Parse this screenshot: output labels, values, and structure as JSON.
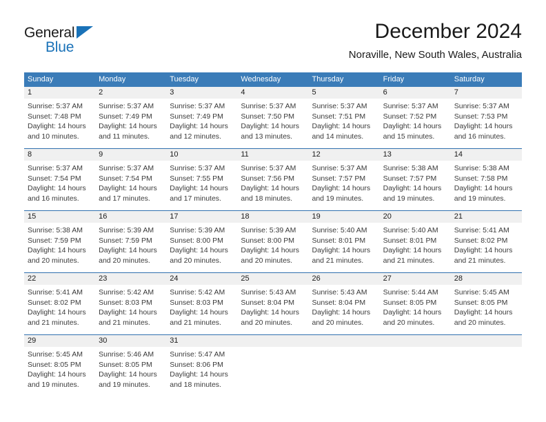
{
  "brand": {
    "name_dark": "General",
    "name_blue": "Blue",
    "triangle_icon": "triangle-icon",
    "accent_color": "#1a72b8"
  },
  "header": {
    "title": "December 2024",
    "subtitle": "Noraville, New South Wales, Australia"
  },
  "theme": {
    "header_blue": "#3b7cb8",
    "daynum_band": "#f0f0f0",
    "rule_blue": "#2f6fae",
    "text": "#3a3a3a"
  },
  "labels": {
    "sunrise_prefix": "Sunrise:",
    "sunset_prefix": "Sunset:",
    "daylight_prefix": "Daylight:"
  },
  "weekdays": [
    "Sunday",
    "Monday",
    "Tuesday",
    "Wednesday",
    "Thursday",
    "Friday",
    "Saturday"
  ],
  "weeks": [
    {
      "days": [
        {
          "day": "1",
          "sunrise": "Sunrise: 5:37 AM",
          "sunset": "Sunset: 7:48 PM",
          "daylight": "Daylight: 14 hours and 10 minutes."
        },
        {
          "day": "2",
          "sunrise": "Sunrise: 5:37 AM",
          "sunset": "Sunset: 7:49 PM",
          "daylight": "Daylight: 14 hours and 11 minutes."
        },
        {
          "day": "3",
          "sunrise": "Sunrise: 5:37 AM",
          "sunset": "Sunset: 7:49 PM",
          "daylight": "Daylight: 14 hours and 12 minutes."
        },
        {
          "day": "4",
          "sunrise": "Sunrise: 5:37 AM",
          "sunset": "Sunset: 7:50 PM",
          "daylight": "Daylight: 14 hours and 13 minutes."
        },
        {
          "day": "5",
          "sunrise": "Sunrise: 5:37 AM",
          "sunset": "Sunset: 7:51 PM",
          "daylight": "Daylight: 14 hours and 14 minutes."
        },
        {
          "day": "6",
          "sunrise": "Sunrise: 5:37 AM",
          "sunset": "Sunset: 7:52 PM",
          "daylight": "Daylight: 14 hours and 15 minutes."
        },
        {
          "day": "7",
          "sunrise": "Sunrise: 5:37 AM",
          "sunset": "Sunset: 7:53 PM",
          "daylight": "Daylight: 14 hours and 16 minutes."
        }
      ]
    },
    {
      "days": [
        {
          "day": "8",
          "sunrise": "Sunrise: 5:37 AM",
          "sunset": "Sunset: 7:54 PM",
          "daylight": "Daylight: 14 hours and 16 minutes."
        },
        {
          "day": "9",
          "sunrise": "Sunrise: 5:37 AM",
          "sunset": "Sunset: 7:54 PM",
          "daylight": "Daylight: 14 hours and 17 minutes."
        },
        {
          "day": "10",
          "sunrise": "Sunrise: 5:37 AM",
          "sunset": "Sunset: 7:55 PM",
          "daylight": "Daylight: 14 hours and 17 minutes."
        },
        {
          "day": "11",
          "sunrise": "Sunrise: 5:37 AM",
          "sunset": "Sunset: 7:56 PM",
          "daylight": "Daylight: 14 hours and 18 minutes."
        },
        {
          "day": "12",
          "sunrise": "Sunrise: 5:37 AM",
          "sunset": "Sunset: 7:57 PM",
          "daylight": "Daylight: 14 hours and 19 minutes."
        },
        {
          "day": "13",
          "sunrise": "Sunrise: 5:38 AM",
          "sunset": "Sunset: 7:57 PM",
          "daylight": "Daylight: 14 hours and 19 minutes."
        },
        {
          "day": "14",
          "sunrise": "Sunrise: 5:38 AM",
          "sunset": "Sunset: 7:58 PM",
          "daylight": "Daylight: 14 hours and 19 minutes."
        }
      ]
    },
    {
      "days": [
        {
          "day": "15",
          "sunrise": "Sunrise: 5:38 AM",
          "sunset": "Sunset: 7:59 PM",
          "daylight": "Daylight: 14 hours and 20 minutes."
        },
        {
          "day": "16",
          "sunrise": "Sunrise: 5:39 AM",
          "sunset": "Sunset: 7:59 PM",
          "daylight": "Daylight: 14 hours and 20 minutes."
        },
        {
          "day": "17",
          "sunrise": "Sunrise: 5:39 AM",
          "sunset": "Sunset: 8:00 PM",
          "daylight": "Daylight: 14 hours and 20 minutes."
        },
        {
          "day": "18",
          "sunrise": "Sunrise: 5:39 AM",
          "sunset": "Sunset: 8:00 PM",
          "daylight": "Daylight: 14 hours and 20 minutes."
        },
        {
          "day": "19",
          "sunrise": "Sunrise: 5:40 AM",
          "sunset": "Sunset: 8:01 PM",
          "daylight": "Daylight: 14 hours and 21 minutes."
        },
        {
          "day": "20",
          "sunrise": "Sunrise: 5:40 AM",
          "sunset": "Sunset: 8:01 PM",
          "daylight": "Daylight: 14 hours and 21 minutes."
        },
        {
          "day": "21",
          "sunrise": "Sunrise: 5:41 AM",
          "sunset": "Sunset: 8:02 PM",
          "daylight": "Daylight: 14 hours and 21 minutes."
        }
      ]
    },
    {
      "days": [
        {
          "day": "22",
          "sunrise": "Sunrise: 5:41 AM",
          "sunset": "Sunset: 8:02 PM",
          "daylight": "Daylight: 14 hours and 21 minutes."
        },
        {
          "day": "23",
          "sunrise": "Sunrise: 5:42 AM",
          "sunset": "Sunset: 8:03 PM",
          "daylight": "Daylight: 14 hours and 21 minutes."
        },
        {
          "day": "24",
          "sunrise": "Sunrise: 5:42 AM",
          "sunset": "Sunset: 8:03 PM",
          "daylight": "Daylight: 14 hours and 21 minutes."
        },
        {
          "day": "25",
          "sunrise": "Sunrise: 5:43 AM",
          "sunset": "Sunset: 8:04 PM",
          "daylight": "Daylight: 14 hours and 20 minutes."
        },
        {
          "day": "26",
          "sunrise": "Sunrise: 5:43 AM",
          "sunset": "Sunset: 8:04 PM",
          "daylight": "Daylight: 14 hours and 20 minutes."
        },
        {
          "day": "27",
          "sunrise": "Sunrise: 5:44 AM",
          "sunset": "Sunset: 8:05 PM",
          "daylight": "Daylight: 14 hours and 20 minutes."
        },
        {
          "day": "28",
          "sunrise": "Sunrise: 5:45 AM",
          "sunset": "Sunset: 8:05 PM",
          "daylight": "Daylight: 14 hours and 20 minutes."
        }
      ]
    },
    {
      "days": [
        {
          "day": "29",
          "sunrise": "Sunrise: 5:45 AM",
          "sunset": "Sunset: 8:05 PM",
          "daylight": "Daylight: 14 hours and 19 minutes."
        },
        {
          "day": "30",
          "sunrise": "Sunrise: 5:46 AM",
          "sunset": "Sunset: 8:05 PM",
          "daylight": "Daylight: 14 hours and 19 minutes."
        },
        {
          "day": "31",
          "sunrise": "Sunrise: 5:47 AM",
          "sunset": "Sunset: 8:06 PM",
          "daylight": "Daylight: 14 hours and 18 minutes."
        },
        {
          "day": "",
          "sunrise": "",
          "sunset": "",
          "daylight": ""
        },
        {
          "day": "",
          "sunrise": "",
          "sunset": "",
          "daylight": ""
        },
        {
          "day": "",
          "sunrise": "",
          "sunset": "",
          "daylight": ""
        },
        {
          "day": "",
          "sunrise": "",
          "sunset": "",
          "daylight": ""
        }
      ]
    }
  ]
}
